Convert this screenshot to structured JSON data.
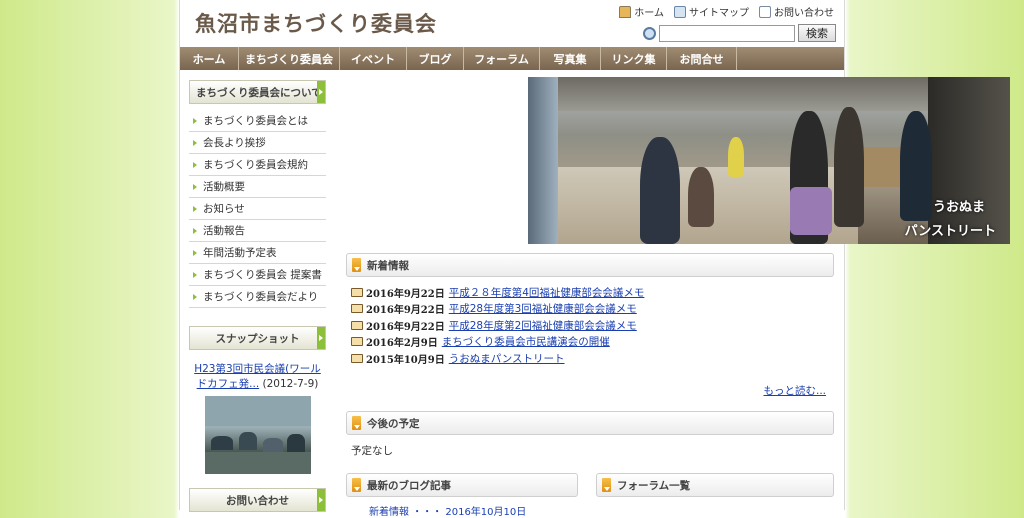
{
  "header": {
    "site_title": "魚沼市まちづくり委員会",
    "links": [
      {
        "label": "ホーム",
        "icon": "home-icon"
      },
      {
        "label": "サイトマップ",
        "icon": "sitemap-icon"
      },
      {
        "label": "お問い合わせ",
        "icon": "mail-icon"
      }
    ],
    "search": {
      "placeholder": "",
      "button_label": "検索"
    }
  },
  "nav": {
    "items": [
      "ホーム",
      "まちづくり委員会",
      "イベント",
      "ブログ",
      "フォーラム",
      "写真集",
      "リンク集",
      "お問合せ"
    ]
  },
  "sidebar": {
    "about_header": "まちづくり委員会について",
    "menu": [
      "まちづくり委員会とは",
      "会長より挨拶",
      "まちづくり委員会規約",
      "活動概要",
      "お知らせ",
      "活動報告",
      "年間活動予定表",
      "まちづくり委員会 提案書",
      "まちづくり委員会だより"
    ],
    "snapshot_header": "スナップショット",
    "snapshot_link": "H23第3回市民会議(ワールドカフェ発...",
    "snapshot_date": "(2012-7-9)",
    "contact_header": "お問い合わせ"
  },
  "hero": {
    "caption_line1": "うおぬま",
    "caption_line2": "パンストリート"
  },
  "news": {
    "header": "新着情報",
    "items": [
      {
        "date": "2016年9月22日",
        "title": "平成２８年度第4回福祉健康部会会議メモ"
      },
      {
        "date": "2016年9月22日",
        "title": "平成28年度第3回福祉健康部会会議メモ"
      },
      {
        "date": "2016年9月22日",
        "title": "平成28年度第2回福祉健康部会会議メモ"
      },
      {
        "date": "2016年2月9日",
        "title": "まちづくり委員会市民講演会の開催"
      },
      {
        "date": "2015年10月9日",
        "title": "うおぬまパンストリート"
      }
    ],
    "more": "もっと読む..."
  },
  "schedule": {
    "header": "今後の予定",
    "text": "予定なし"
  },
  "blog": {
    "header": "最新のブログ記事",
    "partial_text": "新着情報 ・・・ 2016年10月10日"
  },
  "forum": {
    "header": "フォーラム一覧"
  }
}
